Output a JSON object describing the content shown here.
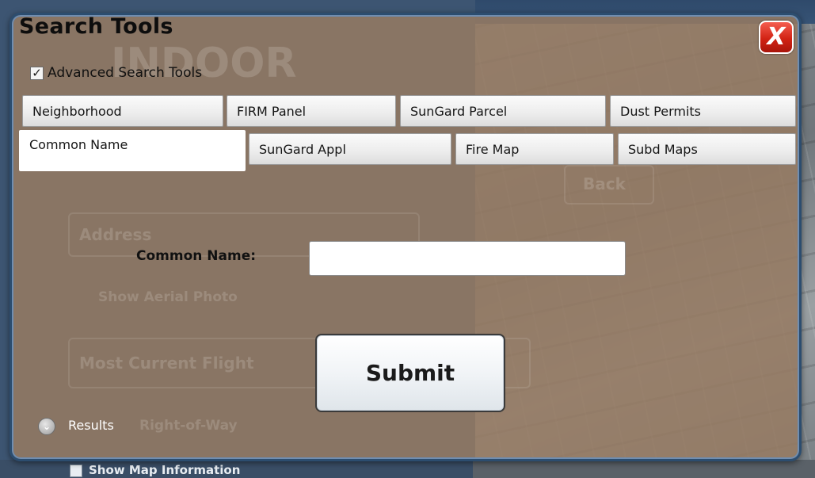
{
  "background": {
    "ghost_logo": "INDOOR",
    "ghost_back": "Back",
    "ghost_address": "Address",
    "ghost_show_aerial": "Show Aerial Photo",
    "ghost_flight": "Most Current Flight",
    "ghost_row": "Right-of-Way",
    "bottom_check_label": "Show Map Information"
  },
  "dialog": {
    "title": "Search Tools",
    "close_label": "X",
    "advanced_checkbox": {
      "label": "Advanced Search Tools",
      "checked": true,
      "mark": "✓"
    },
    "tabs_row1": [
      "Neighborhood",
      "FIRM Panel",
      "SunGard Parcel",
      "Dust Permits"
    ],
    "tabs_row2": [
      "Common Name",
      "SunGard Appl",
      "Fire Map",
      "Subd Maps"
    ],
    "active_tab": "Common Name",
    "form": {
      "common_name_label": "Common Name:",
      "common_name_value": "",
      "common_name_placeholder": ""
    },
    "submit_label": "Submit",
    "results_label": "Results",
    "results_icon": "chevron-down-icon"
  }
}
